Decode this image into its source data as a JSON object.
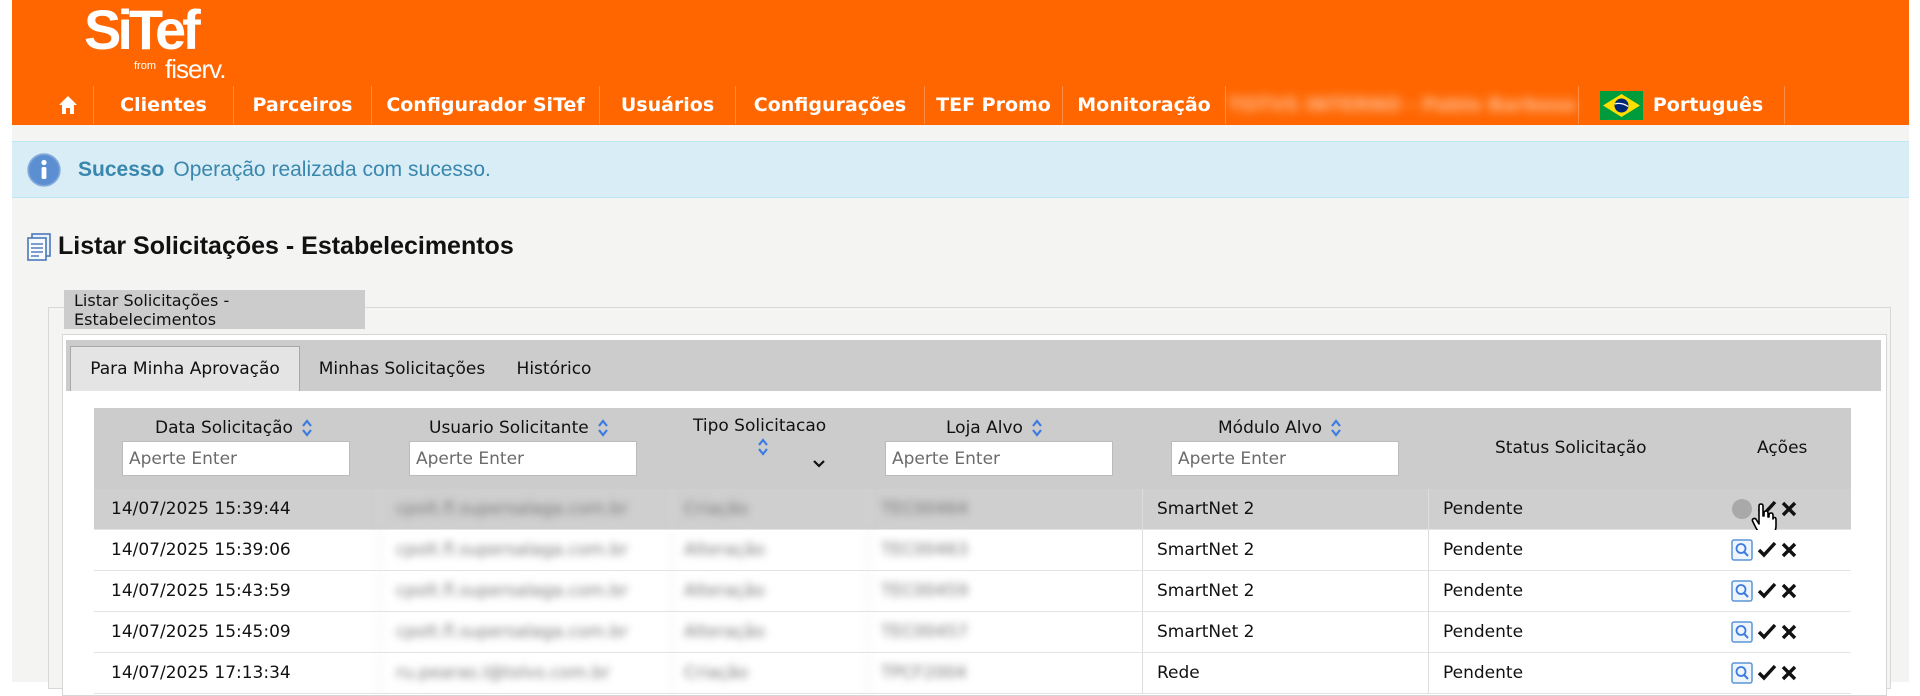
{
  "brand": {
    "name": "SiTef",
    "from": "from",
    "company": "fiserv."
  },
  "nav": {
    "items": [
      "Clientes",
      "Parceiros",
      "Configurador SiTef",
      "Usuários",
      "Configurações",
      "TEF Promo",
      "Monitoração"
    ],
    "user_label": "TOTVS INTERNO - Pablo Barbosa",
    "language": "Português"
  },
  "alert": {
    "title": "Sucesso",
    "message": "Operação realizada com sucesso."
  },
  "page": {
    "title": "Listar Solicitações - Estabelecimentos"
  },
  "panel": {
    "legend": "Listar Solicitações - Estabelecimentos"
  },
  "tabs": [
    {
      "label": "Para Minha Aprovação",
      "active": true
    },
    {
      "label": "Minhas Solicitações",
      "active": false
    },
    {
      "label": "Histórico",
      "active": false
    }
  ],
  "table": {
    "columns": {
      "data": "Data Solicitação",
      "usuario": "Usuario Solicitante",
      "tipo": "Tipo Solicitacao",
      "loja": "Loja Alvo",
      "modulo": "Módulo Alvo",
      "status": "Status Solicitação",
      "acoes": "Ações"
    },
    "filter_placeholder": "Aperte Enter",
    "rows": [
      {
        "data": "14/07/2025 15:39:44",
        "usuario": "cpolt.fl.supersalaga.com.br",
        "tipo": "Criação",
        "loja": "TEC00464",
        "modulo": "SmartNet 2",
        "status": "Pendente"
      },
      {
        "data": "14/07/2025 15:39:06",
        "usuario": "cpolt.fl.supersalaga.com.br",
        "tipo": "Alteração",
        "loja": "TEC00463",
        "modulo": "SmartNet 2",
        "status": "Pendente"
      },
      {
        "data": "14/07/2025 15:43:59",
        "usuario": "cpolt.fl.supersalaga.com.br",
        "tipo": "Alteração",
        "loja": "TEC00459",
        "modulo": "SmartNet 2",
        "status": "Pendente"
      },
      {
        "data": "14/07/2025 15:45:09",
        "usuario": "cpolt.fl.supersalaga.com.br",
        "tipo": "Alteração",
        "loja": "TEC00457",
        "modulo": "SmartNet 2",
        "status": "Pendente"
      },
      {
        "data": "14/07/2025 17:13:34",
        "usuario": "ru.pearas.l@tolvs.com.br",
        "tipo": "Criação",
        "loja": "TPCF2004",
        "modulo": "Rede",
        "status": "Pendente"
      }
    ]
  },
  "colors": {
    "header": "#ff6600",
    "alert_bg": "#d9edf7",
    "alert_text": "#3a87ad",
    "grid_header": "#cccccc"
  },
  "icons": {
    "home": "home-icon",
    "flag": "brazil-flag-icon",
    "info": "info-icon",
    "doc": "document-list-icon",
    "sort": "sort-icon",
    "dropdown": "chevron-down-icon",
    "view": "magnifier-icon",
    "approve": "check-icon",
    "reject": "close-icon",
    "cursor": "hand-cursor-icon"
  }
}
